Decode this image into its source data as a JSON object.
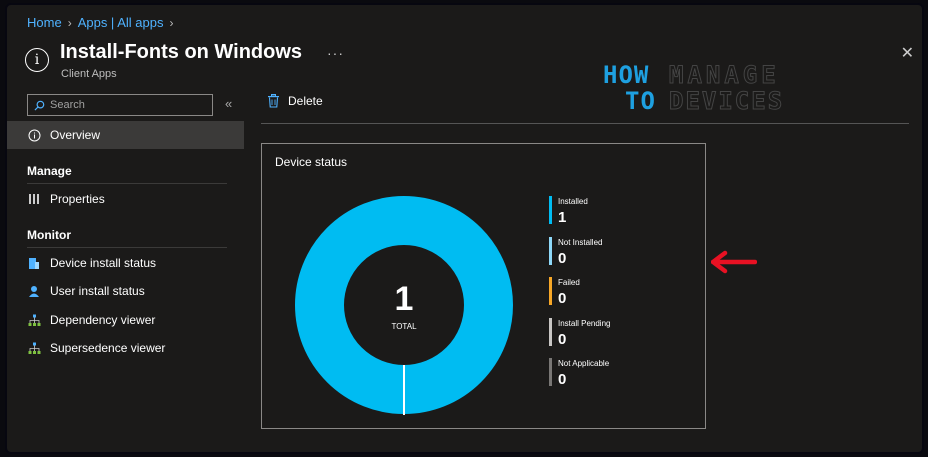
{
  "breadcrumb": {
    "home": "Home",
    "apps": "Apps | All apps"
  },
  "header": {
    "title": "Install-Fonts on Windows",
    "subtitle": "Client Apps",
    "more": "···",
    "close": "✕"
  },
  "logo": {
    "line1a": "HOW",
    "line1b": "MANAGE",
    "line2a": "TO",
    "line2b": "DEVICES"
  },
  "sidebar": {
    "search_placeholder": "Search",
    "collapse": "«",
    "overview": "Overview",
    "manage_heading": "Manage",
    "properties": "Properties",
    "monitor_heading": "Monitor",
    "monitor_items": [
      "Device install status",
      "User install status",
      "Dependency viewer",
      "Supersedence viewer"
    ]
  },
  "toolbar": {
    "delete_label": "Delete"
  },
  "device_status": {
    "title": "Device status",
    "total_value": "1",
    "total_label": "TOTAL",
    "legend": [
      {
        "label": "Installed",
        "value": "1",
        "color": "#00bcf2"
      },
      {
        "label": "Not Installed",
        "value": "0",
        "color": "#8ed8f8"
      },
      {
        "label": "Failed",
        "value": "0",
        "color": "#f7a727"
      },
      {
        "label": "Install Pending",
        "value": "0",
        "color": "#c8c6c4"
      },
      {
        "label": "Not Applicable",
        "value": "0",
        "color": "#797775"
      }
    ],
    "ring_color": "#00bcf2"
  },
  "colors": {
    "accent": "#4fb2ff",
    "annotation_arrow": "#e81123"
  }
}
